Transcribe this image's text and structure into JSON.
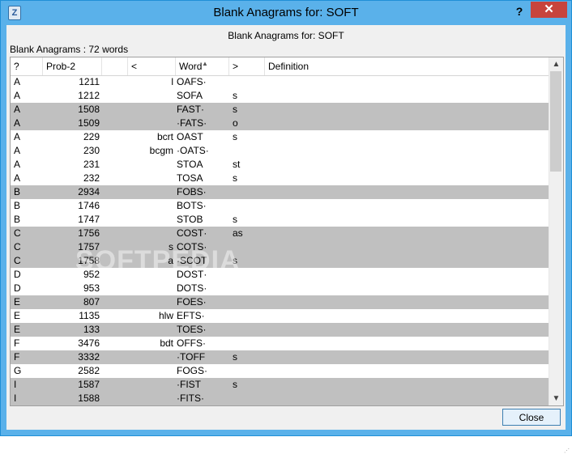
{
  "window": {
    "title": "Blank Anagrams for: SOFT",
    "app_icon_glyph": "Z",
    "help_glyph": "?",
    "close_glyph": "✕"
  },
  "heading": "Blank Anagrams for: SOFT",
  "count_label": "Blank Anagrams : 72 words",
  "columns": {
    "q": "?",
    "prob": "Prob-2",
    "blank": "",
    "lt": "<",
    "word": "Word",
    "gt": ">",
    "def": "Definition"
  },
  "rows": [
    {
      "q": "A",
      "prob": "1211",
      "lt": "l",
      "word": "OAFS·",
      "gt": "",
      "def": "",
      "hl": false
    },
    {
      "q": "A",
      "prob": "1212",
      "lt": "",
      "word": "SOFA",
      "gt": "s",
      "def": "",
      "hl": false
    },
    {
      "q": "A",
      "prob": "1508",
      "lt": "",
      "word": "FAST·",
      "gt": "s",
      "def": "",
      "hl": true
    },
    {
      "q": "A",
      "prob": "1509",
      "lt": "",
      "word": "·FATS·",
      "gt": "o",
      "def": "",
      "hl": true
    },
    {
      "q": "A",
      "prob": "229",
      "lt": "bcrt",
      "word": "OAST",
      "gt": "s",
      "def": "",
      "hl": false
    },
    {
      "q": "A",
      "prob": "230",
      "lt": "bcgm",
      "word": "·OATS·",
      "gt": "",
      "def": "",
      "hl": false
    },
    {
      "q": "A",
      "prob": "231",
      "lt": "",
      "word": "STOA",
      "gt": "st",
      "def": "",
      "hl": false
    },
    {
      "q": "A",
      "prob": "232",
      "lt": "",
      "word": "TOSA",
      "gt": "s",
      "def": "",
      "hl": false
    },
    {
      "q": "B",
      "prob": "2934",
      "lt": "",
      "word": "FOBS·",
      "gt": "",
      "def": "",
      "hl": true
    },
    {
      "q": "B",
      "prob": "1746",
      "lt": "",
      "word": "BOTS·",
      "gt": "",
      "def": "",
      "hl": false
    },
    {
      "q": "B",
      "prob": "1747",
      "lt": "",
      "word": "STOB",
      "gt": "s",
      "def": "",
      "hl": false
    },
    {
      "q": "C",
      "prob": "1756",
      "lt": "",
      "word": "COST·",
      "gt": "as",
      "def": "",
      "hl": true
    },
    {
      "q": "C",
      "prob": "1757",
      "lt": "s",
      "word": "COTS·",
      "gt": "",
      "def": "",
      "hl": true
    },
    {
      "q": "C",
      "prob": "1758",
      "lt": "a",
      "word": "·SCOT",
      "gt": "s",
      "def": "",
      "hl": true
    },
    {
      "q": "D",
      "prob": "952",
      "lt": "",
      "word": "DOST·",
      "gt": "",
      "def": "",
      "hl": false
    },
    {
      "q": "D",
      "prob": "953",
      "lt": "",
      "word": "DOTS·",
      "gt": "",
      "def": "",
      "hl": false
    },
    {
      "q": "E",
      "prob": "807",
      "lt": "",
      "word": "FOES·",
      "gt": "",
      "def": "",
      "hl": true
    },
    {
      "q": "E",
      "prob": "1135",
      "lt": "hlw",
      "word": "EFTS·",
      "gt": "",
      "def": "",
      "hl": false
    },
    {
      "q": "E",
      "prob": "133",
      "lt": "",
      "word": "TOES·",
      "gt": "",
      "def": "",
      "hl": true
    },
    {
      "q": "F",
      "prob": "3476",
      "lt": "bdt",
      "word": "OFFS·",
      "gt": "",
      "def": "",
      "hl": false
    },
    {
      "q": "F",
      "prob": "3332",
      "lt": "",
      "word": "·TOFF",
      "gt": "s",
      "def": "",
      "hl": true
    },
    {
      "q": "G",
      "prob": "2582",
      "lt": "",
      "word": "FOGS·",
      "gt": "",
      "def": "",
      "hl": false
    },
    {
      "q": "I",
      "prob": "1587",
      "lt": "",
      "word": "·FIST",
      "gt": "s",
      "def": "",
      "hl": true
    },
    {
      "q": "I",
      "prob": "1588",
      "lt": "",
      "word": "·FITS·",
      "gt": "",
      "def": "",
      "hl": true
    }
  ],
  "scroll": {
    "up": "▲",
    "down": "▼"
  },
  "close_button": "Close",
  "watermark": "SOFTPEDIA",
  "colors": {
    "titlebar": "#5ab1ea",
    "highlight_row": "#c0c0c0",
    "close_x": "#c7443c"
  }
}
